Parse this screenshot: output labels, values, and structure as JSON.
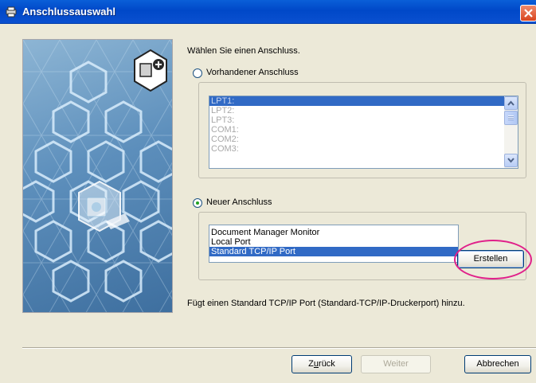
{
  "window": {
    "title": "Anschlussauswahl",
    "title_icon": "printer-icon",
    "close_icon": "close-icon"
  },
  "panel": {
    "heading": "Wählen Sie einen Anschluss.",
    "existing_port_label": "Vorhandener Anschluss",
    "existing_ports": [
      "LPT1:",
      "LPT2:",
      "LPT3:",
      "COM1:",
      "COM2:",
      "COM3:"
    ],
    "existing_selected": "LPT1:",
    "new_port_label": "Neuer Anschluss",
    "new_port_selected_option": "new",
    "new_port_types": [
      "Document Manager Monitor",
      "Local Port",
      "Standard TCP/IP Port"
    ],
    "new_port_type_selected": "Standard TCP/IP Port",
    "create_button": "Erstellen",
    "description": "Fügt einen Standard TCP/IP Port (Standard-TCP/IP-Druckerport) hinzu."
  },
  "footer": {
    "back_button": "Zurück",
    "back_button_accesskey": "u",
    "next_button": "Weiter",
    "cancel_button": "Abbrechen"
  },
  "colors": {
    "selection": "#316ac5",
    "annotation_ring": "#e0208a",
    "title_bar": "#0a5fd8"
  }
}
